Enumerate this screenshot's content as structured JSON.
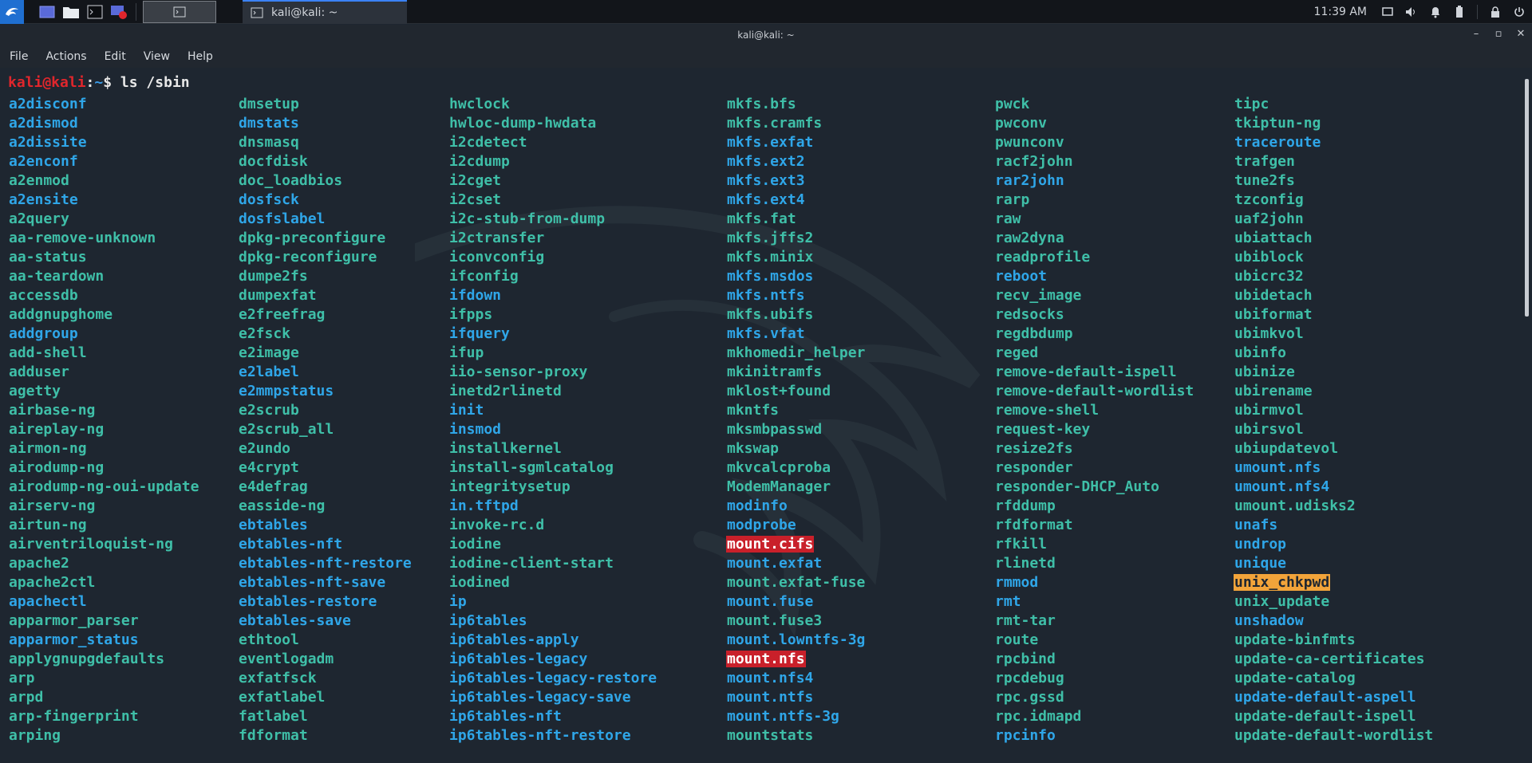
{
  "panel": {
    "clock": "11:39 AM",
    "task_label": "kali@kali: ~"
  },
  "window": {
    "title": "kali@kali: ~",
    "menu": [
      "File",
      "Actions",
      "Edit",
      "View",
      "Help"
    ]
  },
  "terminal": {
    "prompt_user": "kali@kali",
    "prompt_colon": ":",
    "prompt_path": "~",
    "prompt_symbol": "$ ",
    "command": "ls /sbin",
    "columns": [
      {
        "entries": [
          {
            "name": "a2disconf",
            "type": "link"
          },
          {
            "name": "a2dismod",
            "type": "link"
          },
          {
            "name": "a2dissite",
            "type": "link"
          },
          {
            "name": "a2enconf",
            "type": "link"
          },
          {
            "name": "a2enmod",
            "type": "exec"
          },
          {
            "name": "a2ensite",
            "type": "link"
          },
          {
            "name": "a2query",
            "type": "exec"
          },
          {
            "name": "aa-remove-unknown",
            "type": "exec"
          },
          {
            "name": "aa-status",
            "type": "exec"
          },
          {
            "name": "aa-teardown",
            "type": "exec"
          },
          {
            "name": "accessdb",
            "type": "exec"
          },
          {
            "name": "addgnupghome",
            "type": "exec"
          },
          {
            "name": "addgroup",
            "type": "link"
          },
          {
            "name": "add-shell",
            "type": "exec"
          },
          {
            "name": "adduser",
            "type": "exec"
          },
          {
            "name": "agetty",
            "type": "exec"
          },
          {
            "name": "airbase-ng",
            "type": "exec"
          },
          {
            "name": "aireplay-ng",
            "type": "exec"
          },
          {
            "name": "airmon-ng",
            "type": "exec"
          },
          {
            "name": "airodump-ng",
            "type": "exec"
          },
          {
            "name": "airodump-ng-oui-update",
            "type": "exec"
          },
          {
            "name": "airserv-ng",
            "type": "exec"
          },
          {
            "name": "airtun-ng",
            "type": "exec"
          },
          {
            "name": "airventriloquist-ng",
            "type": "exec"
          },
          {
            "name": "apache2",
            "type": "exec"
          },
          {
            "name": "apache2ctl",
            "type": "exec"
          },
          {
            "name": "apachectl",
            "type": "link"
          },
          {
            "name": "apparmor_parser",
            "type": "exec"
          },
          {
            "name": "apparmor_status",
            "type": "link"
          },
          {
            "name": "applygnupgdefaults",
            "type": "exec"
          },
          {
            "name": "arp",
            "type": "exec"
          },
          {
            "name": "arpd",
            "type": "exec"
          },
          {
            "name": "arp-fingerprint",
            "type": "exec"
          },
          {
            "name": "arping",
            "type": "exec"
          }
        ]
      },
      {
        "entries": [
          {
            "name": "dmsetup",
            "type": "exec"
          },
          {
            "name": "dmstats",
            "type": "link"
          },
          {
            "name": "dnsmasq",
            "type": "exec"
          },
          {
            "name": "docfdisk",
            "type": "exec"
          },
          {
            "name": "doc_loadbios",
            "type": "exec"
          },
          {
            "name": "dosfsck",
            "type": "link"
          },
          {
            "name": "dosfslabel",
            "type": "link"
          },
          {
            "name": "dpkg-preconfigure",
            "type": "exec"
          },
          {
            "name": "dpkg-reconfigure",
            "type": "exec"
          },
          {
            "name": "dumpe2fs",
            "type": "exec"
          },
          {
            "name": "dumpexfat",
            "type": "exec"
          },
          {
            "name": "e2freefrag",
            "type": "exec"
          },
          {
            "name": "e2fsck",
            "type": "exec"
          },
          {
            "name": "e2image",
            "type": "exec"
          },
          {
            "name": "e2label",
            "type": "link"
          },
          {
            "name": "e2mmpstatus",
            "type": "link"
          },
          {
            "name": "e2scrub",
            "type": "exec"
          },
          {
            "name": "e2scrub_all",
            "type": "exec"
          },
          {
            "name": "e2undo",
            "type": "exec"
          },
          {
            "name": "e4crypt",
            "type": "exec"
          },
          {
            "name": "e4defrag",
            "type": "exec"
          },
          {
            "name": "easside-ng",
            "type": "exec"
          },
          {
            "name": "ebtables",
            "type": "link"
          },
          {
            "name": "ebtables-nft",
            "type": "link"
          },
          {
            "name": "ebtables-nft-restore",
            "type": "link"
          },
          {
            "name": "ebtables-nft-save",
            "type": "link"
          },
          {
            "name": "ebtables-restore",
            "type": "link"
          },
          {
            "name": "ebtables-save",
            "type": "link"
          },
          {
            "name": "ethtool",
            "type": "exec"
          },
          {
            "name": "eventlogadm",
            "type": "exec"
          },
          {
            "name": "exfatfsck",
            "type": "exec"
          },
          {
            "name": "exfatlabel",
            "type": "exec"
          },
          {
            "name": "fatlabel",
            "type": "exec"
          },
          {
            "name": "fdformat",
            "type": "exec"
          }
        ]
      },
      {
        "entries": [
          {
            "name": "hwclock",
            "type": "exec"
          },
          {
            "name": "hwloc-dump-hwdata",
            "type": "exec"
          },
          {
            "name": "i2cdetect",
            "type": "exec"
          },
          {
            "name": "i2cdump",
            "type": "exec"
          },
          {
            "name": "i2cget",
            "type": "exec"
          },
          {
            "name": "i2cset",
            "type": "exec"
          },
          {
            "name": "i2c-stub-from-dump",
            "type": "exec"
          },
          {
            "name": "i2ctransfer",
            "type": "exec"
          },
          {
            "name": "iconvconfig",
            "type": "exec"
          },
          {
            "name": "ifconfig",
            "type": "exec"
          },
          {
            "name": "ifdown",
            "type": "link"
          },
          {
            "name": "ifpps",
            "type": "exec"
          },
          {
            "name": "ifquery",
            "type": "link"
          },
          {
            "name": "ifup",
            "type": "exec"
          },
          {
            "name": "iio-sensor-proxy",
            "type": "exec"
          },
          {
            "name": "inetd2rlinetd",
            "type": "exec"
          },
          {
            "name": "init",
            "type": "link"
          },
          {
            "name": "insmod",
            "type": "link"
          },
          {
            "name": "installkernel",
            "type": "exec"
          },
          {
            "name": "install-sgmlcatalog",
            "type": "exec"
          },
          {
            "name": "integritysetup",
            "type": "exec"
          },
          {
            "name": "in.tftpd",
            "type": "link"
          },
          {
            "name": "invoke-rc.d",
            "type": "exec"
          },
          {
            "name": "iodine",
            "type": "exec"
          },
          {
            "name": "iodine-client-start",
            "type": "exec"
          },
          {
            "name": "iodined",
            "type": "exec"
          },
          {
            "name": "ip",
            "type": "link"
          },
          {
            "name": "ip6tables",
            "type": "link"
          },
          {
            "name": "ip6tables-apply",
            "type": "link"
          },
          {
            "name": "ip6tables-legacy",
            "type": "link"
          },
          {
            "name": "ip6tables-legacy-restore",
            "type": "link"
          },
          {
            "name": "ip6tables-legacy-save",
            "type": "link"
          },
          {
            "name": "ip6tables-nft",
            "type": "link"
          },
          {
            "name": "ip6tables-nft-restore",
            "type": "link"
          }
        ]
      },
      {
        "entries": [
          {
            "name": "mkfs.bfs",
            "type": "exec"
          },
          {
            "name": "mkfs.cramfs",
            "type": "exec"
          },
          {
            "name": "mkfs.exfat",
            "type": "link"
          },
          {
            "name": "mkfs.ext2",
            "type": "link"
          },
          {
            "name": "mkfs.ext3",
            "type": "link"
          },
          {
            "name": "mkfs.ext4",
            "type": "link"
          },
          {
            "name": "mkfs.fat",
            "type": "exec"
          },
          {
            "name": "mkfs.jffs2",
            "type": "exec"
          },
          {
            "name": "mkfs.minix",
            "type": "exec"
          },
          {
            "name": "mkfs.msdos",
            "type": "link"
          },
          {
            "name": "mkfs.ntfs",
            "type": "link"
          },
          {
            "name": "mkfs.ubifs",
            "type": "exec"
          },
          {
            "name": "mkfs.vfat",
            "type": "link"
          },
          {
            "name": "mkhomedir_helper",
            "type": "exec"
          },
          {
            "name": "mkinitramfs",
            "type": "exec"
          },
          {
            "name": "mklost+found",
            "type": "exec"
          },
          {
            "name": "mkntfs",
            "type": "exec"
          },
          {
            "name": "mksmbpasswd",
            "type": "exec"
          },
          {
            "name": "mkswap",
            "type": "exec"
          },
          {
            "name": "mkvcalcproba",
            "type": "exec"
          },
          {
            "name": "ModemManager",
            "type": "exec"
          },
          {
            "name": "modinfo",
            "type": "link"
          },
          {
            "name": "modprobe",
            "type": "link"
          },
          {
            "name": "mount.cifs",
            "type": "red"
          },
          {
            "name": "mount.exfat",
            "type": "link"
          },
          {
            "name": "mount.exfat-fuse",
            "type": "exec"
          },
          {
            "name": "mount.fuse",
            "type": "link"
          },
          {
            "name": "mount.fuse3",
            "type": "exec"
          },
          {
            "name": "mount.lowntfs-3g",
            "type": "link"
          },
          {
            "name": "mount.nfs",
            "type": "red"
          },
          {
            "name": "mount.nfs4",
            "type": "link"
          },
          {
            "name": "mount.ntfs",
            "type": "link"
          },
          {
            "name": "mount.ntfs-3g",
            "type": "link"
          },
          {
            "name": "mountstats",
            "type": "exec"
          }
        ]
      },
      {
        "entries": [
          {
            "name": "pwck",
            "type": "exec"
          },
          {
            "name": "pwconv",
            "type": "exec"
          },
          {
            "name": "pwunconv",
            "type": "exec"
          },
          {
            "name": "racf2john",
            "type": "exec"
          },
          {
            "name": "rar2john",
            "type": "link"
          },
          {
            "name": "rarp",
            "type": "exec"
          },
          {
            "name": "raw",
            "type": "exec"
          },
          {
            "name": "raw2dyna",
            "type": "exec"
          },
          {
            "name": "readprofile",
            "type": "exec"
          },
          {
            "name": "reboot",
            "type": "link"
          },
          {
            "name": "recv_image",
            "type": "exec"
          },
          {
            "name": "redsocks",
            "type": "exec"
          },
          {
            "name": "regdbdump",
            "type": "exec"
          },
          {
            "name": "reged",
            "type": "exec"
          },
          {
            "name": "remove-default-ispell",
            "type": "exec"
          },
          {
            "name": "remove-default-wordlist",
            "type": "exec"
          },
          {
            "name": "remove-shell",
            "type": "exec"
          },
          {
            "name": "request-key",
            "type": "exec"
          },
          {
            "name": "resize2fs",
            "type": "exec"
          },
          {
            "name": "responder",
            "type": "exec"
          },
          {
            "name": "responder-DHCP_Auto",
            "type": "exec"
          },
          {
            "name": "rfddump",
            "type": "exec"
          },
          {
            "name": "rfdformat",
            "type": "exec"
          },
          {
            "name": "rfkill",
            "type": "exec"
          },
          {
            "name": "rlinetd",
            "type": "exec"
          },
          {
            "name": "rmmod",
            "type": "link"
          },
          {
            "name": "rmt",
            "type": "link"
          },
          {
            "name": "rmt-tar",
            "type": "exec"
          },
          {
            "name": "route",
            "type": "exec"
          },
          {
            "name": "rpcbind",
            "type": "exec"
          },
          {
            "name": "rpcdebug",
            "type": "exec"
          },
          {
            "name": "rpc.gssd",
            "type": "exec"
          },
          {
            "name": "rpc.idmapd",
            "type": "exec"
          },
          {
            "name": "rpcinfo",
            "type": "link"
          }
        ]
      },
      {
        "entries": [
          {
            "name": "tipc",
            "type": "exec"
          },
          {
            "name": "tkiptun-ng",
            "type": "exec"
          },
          {
            "name": "traceroute",
            "type": "link"
          },
          {
            "name": "trafgen",
            "type": "exec"
          },
          {
            "name": "tune2fs",
            "type": "exec"
          },
          {
            "name": "tzconfig",
            "type": "exec"
          },
          {
            "name": "uaf2john",
            "type": "exec"
          },
          {
            "name": "ubiattach",
            "type": "exec"
          },
          {
            "name": "ubiblock",
            "type": "exec"
          },
          {
            "name": "ubicrc32",
            "type": "exec"
          },
          {
            "name": "ubidetach",
            "type": "exec"
          },
          {
            "name": "ubiformat",
            "type": "exec"
          },
          {
            "name": "ubimkvol",
            "type": "exec"
          },
          {
            "name": "ubinfo",
            "type": "exec"
          },
          {
            "name": "ubinize",
            "type": "exec"
          },
          {
            "name": "ubirename",
            "type": "exec"
          },
          {
            "name": "ubirmvol",
            "type": "exec"
          },
          {
            "name": "ubirsvol",
            "type": "exec"
          },
          {
            "name": "ubiupdatevol",
            "type": "exec"
          },
          {
            "name": "umount.nfs",
            "type": "link"
          },
          {
            "name": "umount.nfs4",
            "type": "link"
          },
          {
            "name": "umount.udisks2",
            "type": "exec"
          },
          {
            "name": "unafs",
            "type": "link"
          },
          {
            "name": "undrop",
            "type": "link"
          },
          {
            "name": "unique",
            "type": "link"
          },
          {
            "name": "unix_chkpwd",
            "type": "orange"
          },
          {
            "name": "unix_update",
            "type": "exec"
          },
          {
            "name": "unshadow",
            "type": "link"
          },
          {
            "name": "update-binfmts",
            "type": "exec"
          },
          {
            "name": "update-ca-certificates",
            "type": "exec"
          },
          {
            "name": "update-catalog",
            "type": "exec"
          },
          {
            "name": "update-default-aspell",
            "type": "link"
          },
          {
            "name": "update-default-ispell",
            "type": "exec"
          },
          {
            "name": "update-default-wordlist",
            "type": "exec"
          }
        ]
      }
    ]
  },
  "colors": {
    "exec": "#3fbfa8",
    "link": "#2fa6e8",
    "prompt_user": "#e0262c",
    "prompt_path": "#3b9be6",
    "highlight_red": "#c9202a",
    "highlight_orange": "#f2a43a",
    "accent": "#3b82f6"
  },
  "icons": [
    "kali-dragon-icon",
    "desktop-icon",
    "file-manager-icon",
    "terminal-icon",
    "screen-recorder-icon",
    "workspace-icon",
    "display-icon",
    "volume-icon",
    "notification-icon",
    "battery-icon",
    "lock-icon",
    "power-icon"
  ]
}
